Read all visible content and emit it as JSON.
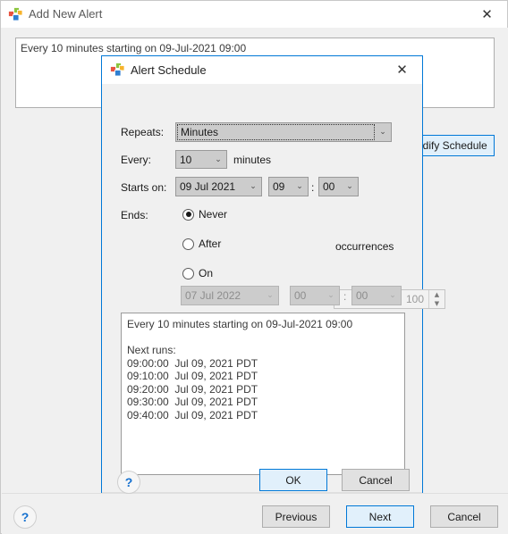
{
  "outer_window": {
    "title": "Add New Alert",
    "icon": "app-cubes-icon",
    "close_icon": "close-icon",
    "summary_text": "Every 10 minutes starting on 09-Jul-2021 09:00",
    "modify_schedule_label": "odify Schedule",
    "help_label": "?",
    "buttons": {
      "previous": "Previous",
      "next": "Next",
      "cancel": "Cancel"
    }
  },
  "dialog": {
    "title": "Alert Schedule",
    "icon": "app-cubes-icon",
    "close_icon": "close-icon",
    "help_label": "?",
    "fields": {
      "repeats_label": "Repeats:",
      "repeats_value": "Minutes",
      "every_label": "Every:",
      "every_value": "10",
      "every_unit": "minutes",
      "starts_on_label": "Starts on:",
      "starts_on_date": "09 Jul 2021",
      "starts_on_hour": "09",
      "time_separator": ":",
      "starts_on_minute": "00"
    },
    "ends": {
      "label": "Ends:",
      "never_label": "Never",
      "after_label": "After",
      "after_value": "100",
      "occurrences_label": "occurrences",
      "on_label": "On",
      "on_date": "07 Jul 2022",
      "on_hour": "00",
      "time_separator": ":",
      "on_minute": "00",
      "selected": "never"
    },
    "preview_text": "Every 10 minutes starting on 09-Jul-2021 09:00\n\nNext runs:\n09:00:00  Jul 09, 2021 PDT\n09:10:00  Jul 09, 2021 PDT\n09:20:00  Jul 09, 2021 PDT\n09:30:00  Jul 09, 2021 PDT\n09:40:00  Jul 09, 2021 PDT",
    "buttons": {
      "ok": "OK",
      "cancel": "Cancel"
    }
  },
  "icons": {
    "chevron_down": "⌄",
    "spin_up": "▲",
    "spin_down": "▼",
    "close": "✕"
  },
  "colors": {
    "accent": "#0078d7",
    "default_button_bg": "#e1f0fb",
    "window_bg": "#f0f0f0",
    "control_bg": "#cccccc",
    "disabled_text": "#9a9a9a"
  }
}
